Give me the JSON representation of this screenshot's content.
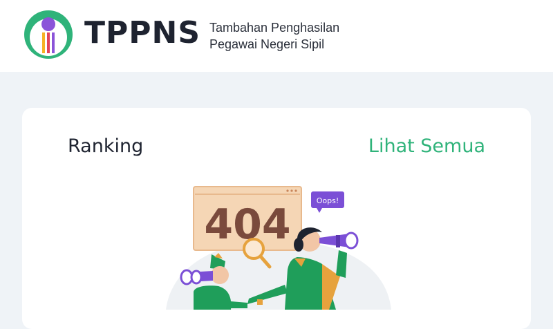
{
  "header": {
    "brand": "TPPNS",
    "tagline_line1": "Tambahan Penghasilan",
    "tagline_line2": "Pegawai Negeri Sipil"
  },
  "ranking": {
    "title": "Ranking",
    "see_all": "Lihat Semua",
    "error_code": "404",
    "error_bubble": "Oops!"
  },
  "colors": {
    "brand_green": "#2fb37a",
    "purple": "#7b4fd6",
    "error_panel": "#f5d6b5"
  },
  "icons": [
    "logo-mark",
    "magnifier-icon",
    "binoculars-icon"
  ]
}
